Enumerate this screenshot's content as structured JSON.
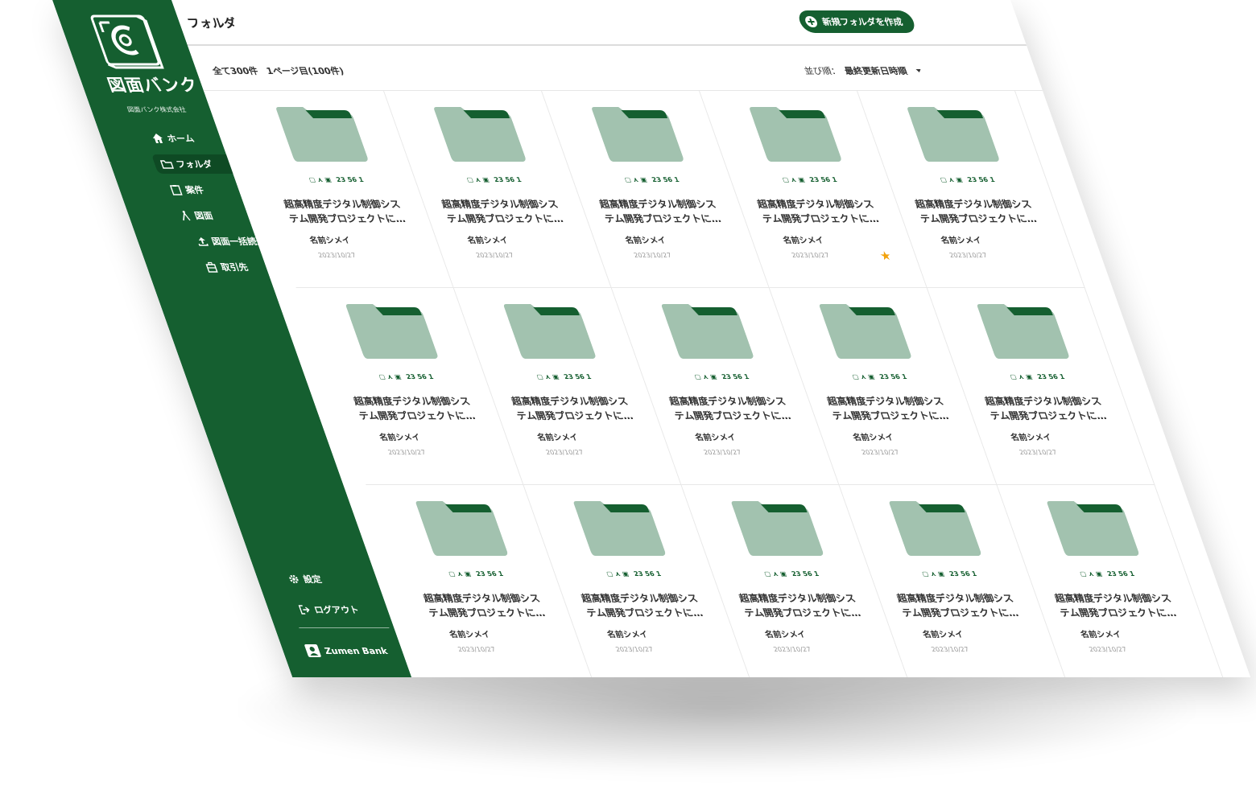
{
  "brand": {
    "name": "図面バンク",
    "company": "図面バンク株式会社"
  },
  "nav": [
    {
      "label": "ホーム",
      "icon": "home-icon"
    },
    {
      "label": "フォルダ",
      "icon": "folder-icon",
      "active": true
    },
    {
      "label": "案件",
      "icon": "clipboard-icon"
    },
    {
      "label": "図面",
      "icon": "compass-icon"
    },
    {
      "label": "図面一括読込",
      "icon": "upload-icon"
    },
    {
      "label": "取引先",
      "icon": "building-icon"
    }
  ],
  "bottom_nav": [
    {
      "label": "設定",
      "icon": "gear-icon"
    },
    {
      "label": "ログアウト",
      "icon": "logout-icon"
    }
  ],
  "user": {
    "name": "Zumen Bank"
  },
  "header": {
    "title": "フォルダ",
    "new_folder_label": "新規フォルダを作成"
  },
  "list_info": {
    "count": "全て300件　1ページ目(100件)",
    "sort_label": "並び順：",
    "sort_value": "最終更新日時順"
  },
  "colors": {
    "brand": "#155f30",
    "folder": "#a2c2af",
    "folder_tab": "#155f30",
    "star": "#f2a20c"
  },
  "cards": [
    {
      "stats": "23 56 1",
      "title_line1": "超高精度デジタル制御シス",
      "title_line2": "テム開発プロジェクトに…",
      "owner": "名前シメイ",
      "date": "2023/10/27",
      "starred": false
    },
    {
      "stats": "23 56 1",
      "title_line1": "超高精度デジタル制御シス",
      "title_line2": "テム開発プロジェクトに…",
      "owner": "名前シメイ",
      "date": "2023/10/27",
      "starred": false
    },
    {
      "stats": "23 56 1",
      "title_line1": "超高精度デジタル制御シス",
      "title_line2": "テム開発プロジェクトに…",
      "owner": "名前シメイ",
      "date": "2023/10/27",
      "starred": false
    },
    {
      "stats": "23 56 1",
      "title_line1": "超高精度デジタル制御シス",
      "title_line2": "テム開発プロジェクトに…",
      "owner": "名前シメイ",
      "date": "2023/10/27",
      "starred": true
    },
    {
      "stats": "23 56 1",
      "title_line1": "超高精度デジタル制御シス",
      "title_line2": "テム開発プロジェクトに…",
      "owner": "名前シメイ",
      "date": "2023/10/27",
      "starred": false
    },
    {
      "stats": "23 56 1",
      "title_line1": "超高精度デジタル制御シス",
      "title_line2": "テム開発プロジェクトに…",
      "owner": "名前シメイ",
      "date": "2023/10/27",
      "starred": false
    },
    {
      "stats": "23 56 1",
      "title_line1": "超高精度デジタル制御シス",
      "title_line2": "テム開発プロジェクトに…",
      "owner": "名前シメイ",
      "date": "2023/10/27",
      "starred": false
    },
    {
      "stats": "23 56 1",
      "title_line1": "超高精度デジタル制御シス",
      "title_line2": "テム開発プロジェクトに…",
      "owner": "名前シメイ",
      "date": "2023/10/27",
      "starred": false
    },
    {
      "stats": "23 56 1",
      "title_line1": "超高精度デジタル制御シス",
      "title_line2": "テム開発プロジェクトに…",
      "owner": "名前シメイ",
      "date": "2023/10/27",
      "starred": false
    },
    {
      "stats": "23 56 1",
      "title_line1": "超高精度デジタル制御シス",
      "title_line2": "テム開発プロジェクトに…",
      "owner": "名前シメイ",
      "date": "2023/10/27",
      "starred": false
    },
    {
      "stats": "23 56 1",
      "title_line1": "超高精度デジタル制御シス",
      "title_line2": "テム開発プロジェクトに…",
      "owner": "名前シメイ",
      "date": "2023/10/27",
      "starred": false
    },
    {
      "stats": "23 56 1",
      "title_line1": "超高精度デジタル制御シス",
      "title_line2": "テム開発プロジェクトに…",
      "owner": "名前シメイ",
      "date": "2023/10/27",
      "starred": false
    },
    {
      "stats": "23 56 1",
      "title_line1": "超高精度デジタル制御シス",
      "title_line2": "テム開発プロジェクトに…",
      "owner": "名前シメイ",
      "date": "2023/10/27",
      "starred": false
    },
    {
      "stats": "23 56 1",
      "title_line1": "超高精度デジタル制御シス",
      "title_line2": "テム開発プロジェクトに…",
      "owner": "名前シメイ",
      "date": "2023/10/27",
      "starred": false
    },
    {
      "stats": "23 56 1",
      "title_line1": "超高精度デジタル制御シス",
      "title_line2": "テム開発プロジェクトに…",
      "owner": "名前シメイ",
      "date": "2023/10/27",
      "starred": false
    }
  ]
}
